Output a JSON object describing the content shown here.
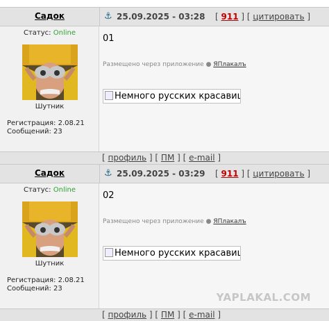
{
  "posts": [
    {
      "author": "Садок",
      "date": "25.09.2025 - 03:28",
      "reply_count": "911",
      "quote_label": "цитировать",
      "status_label": "Статус:",
      "status_value": "Online",
      "rank": "Шутник",
      "registration": "Регистрация: 2.08.21",
      "messages": "Сообщений: 23",
      "text": "01",
      "posted_via": "Размещено через приложение",
      "app_name": "ЯПлакалъ",
      "image_alt": "Немного русских красавиц",
      "footer": {
        "profile": "профиль",
        "pm": "ПМ",
        "email": "e-mail"
      }
    },
    {
      "author": "Садок",
      "date": "25.09.2025 - 03:29",
      "reply_count": "911",
      "quote_label": "цитировать",
      "status_label": "Статус:",
      "status_value": "Online",
      "rank": "Шутник",
      "registration": "Регистрация: 2.08.21",
      "messages": "Сообщений: 23",
      "text": "02",
      "posted_via": "Размещено через приложение",
      "app_name": "ЯПлакалъ",
      "image_alt": "Немного русских красавиц",
      "footer": {
        "profile": "профиль",
        "pm": "ПМ",
        "email": "e-mail"
      }
    }
  ],
  "watermark": "YAPLAKAL.COM",
  "colors": {
    "online": "#2ea12e",
    "count": "#c00000",
    "header_bg": "#e3e3e3"
  },
  "icons": {
    "anchor": "anchor-icon",
    "apple": "apple-icon",
    "broken_image": "broken-image-icon"
  }
}
